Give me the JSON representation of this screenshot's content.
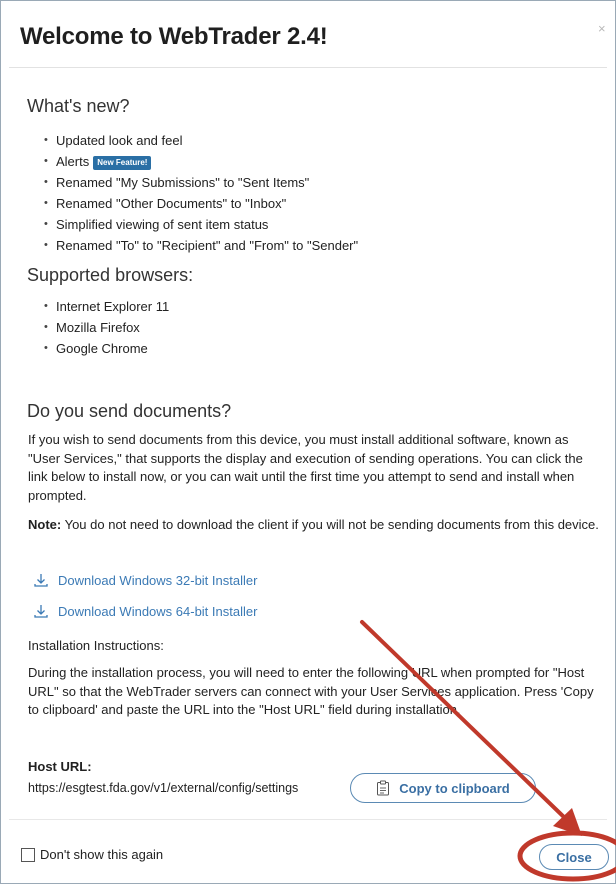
{
  "dialog": {
    "title": "Welcome to WebTrader 2.4!",
    "close_x": "×"
  },
  "whats_new": {
    "heading": "What's new?",
    "items": [
      "Updated look and feel",
      "Alerts",
      "Renamed \"My Submissions\" to \"Sent Items\"",
      "Renamed \"Other Documents\" to \"Inbox\"",
      "Simplified viewing of sent item status",
      "Renamed \"To\" to \"Recipient\" and \"From\" to \"Sender\""
    ],
    "badge": "New Feature!"
  },
  "browsers": {
    "heading": "Supported browsers:",
    "items": [
      "Internet Explorer 11",
      "Mozilla Firefox",
      "Google Chrome"
    ]
  },
  "send_docs": {
    "heading": "Do you send documents?",
    "body": "If you wish to send documents from this device, you must install additional software, known as \"User Services,\" that supports the display and execution of sending operations. You can click the link below to install now, or you can wait until the first time you attempt to send and install when prompted.",
    "note_label": "Note:",
    "note_text": " You do not need to download the client if you will not be sending documents from this device.",
    "link_32": "Download Windows 32-bit Installer",
    "link_64": "Download Windows 64-bit Installer",
    "install_heading": "Installation Instructions:",
    "install_body": "During the installation process, you will need to enter the following URL when prompted for \"Host URL\" so that the WebTrader servers can connect with your User Services application. Press 'Copy to clipboard' and paste the URL into the \"Host URL\" field during installation.",
    "host_label": "Host URL:",
    "host_url": "https://esgtest.fda.gov/v1/external/config/settings",
    "copy_label": "Copy to clipboard"
  },
  "footer": {
    "dont_show": "Don't show this again",
    "close_label": "Close"
  },
  "colors": {
    "accent": "#3b7ab5",
    "badge": "#2a6fa5",
    "annotation": "#c0392b"
  },
  "icons": {
    "download": "download-icon",
    "clipboard": "clipboard-icon"
  }
}
